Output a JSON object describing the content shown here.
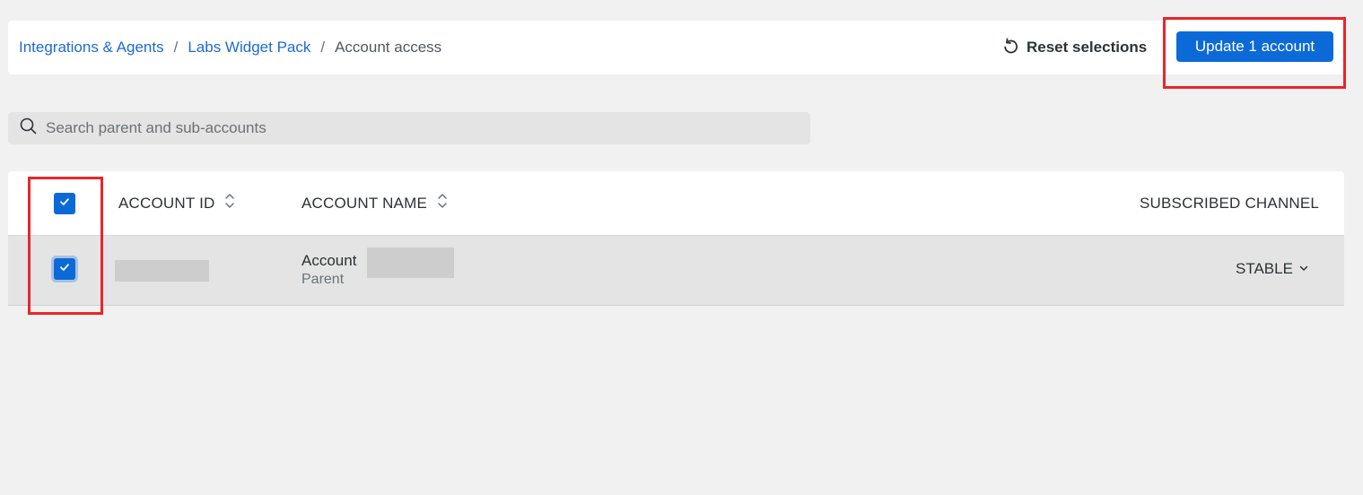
{
  "breadcrumb": {
    "items": [
      {
        "label": "Integrations & Agents"
      },
      {
        "label": "Labs Widget Pack"
      }
    ],
    "separator": "/",
    "current": "Account access"
  },
  "actions": {
    "reset_label": "Reset selections",
    "update_label": "Update 1 account"
  },
  "search": {
    "placeholder": "Search parent and sub-accounts",
    "value": ""
  },
  "table": {
    "columns": {
      "account_id": "ACCOUNT ID",
      "account_name": "ACCOUNT NAME",
      "subscribed_channel": "SUBSCRIBED CHANNEL"
    },
    "rows": [
      {
        "selected": true,
        "account_name": "Account",
        "account_type": "Parent",
        "channel": "STABLE"
      }
    ]
  },
  "colors": {
    "accent": "#0c6ad8",
    "link": "#1d6ad8",
    "highlight": "#e8262a"
  }
}
